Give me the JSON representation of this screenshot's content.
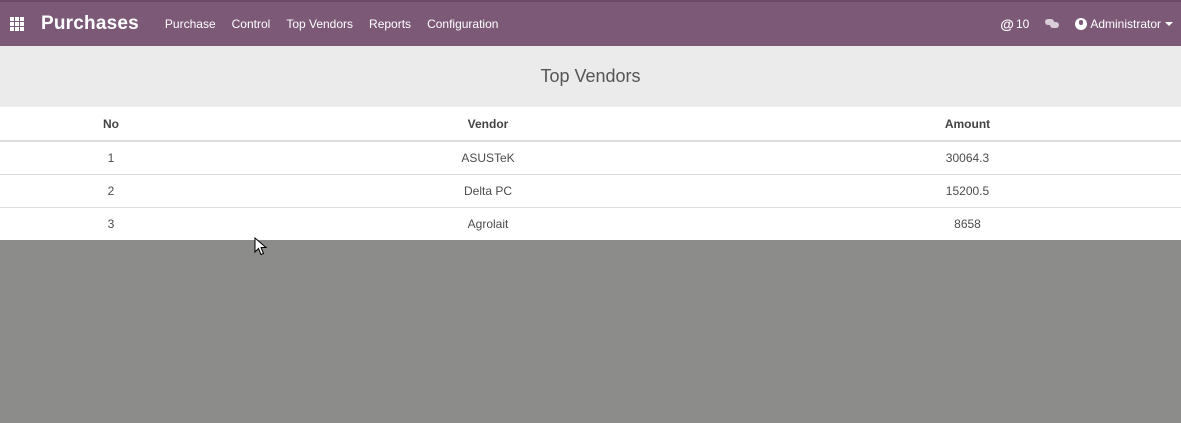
{
  "navbar": {
    "apps_icon": "apps-grid-icon",
    "brand": "Purchases",
    "menu": [
      {
        "label": "Purchase"
      },
      {
        "label": "Control"
      },
      {
        "label": "Top Vendors"
      },
      {
        "label": "Reports"
      },
      {
        "label": "Configuration"
      }
    ],
    "mentions_symbol": "@",
    "mentions_count": "10",
    "chat_icon": "chat-bubbles-icon",
    "user_icon": "user-avatar-icon",
    "user_name": "Administrator",
    "bar_color": "#7c5a77"
  },
  "page": {
    "title": "Top Vendors"
  },
  "table": {
    "headers": [
      "No",
      "Vendor",
      "Amount"
    ],
    "rows": [
      {
        "no": "1",
        "vendor": "ASUSTeK",
        "amount": "30064.3"
      },
      {
        "no": "2",
        "vendor": "Delta PC",
        "amount": "15200.5"
      },
      {
        "no": "3",
        "vendor": "Agrolait",
        "amount": "8658"
      }
    ]
  }
}
